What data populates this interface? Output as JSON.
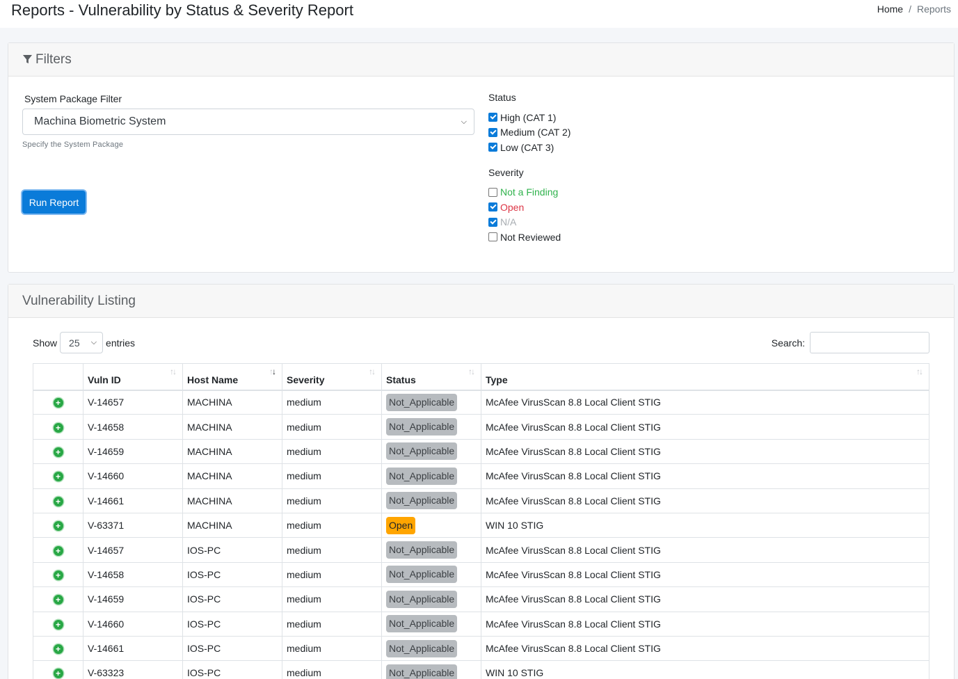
{
  "header": {
    "title": "Reports - Vulnerability by Status & Severity Report"
  },
  "breadcrumb": {
    "home": "Home",
    "separator": "/",
    "current": "Reports"
  },
  "filters": {
    "title": "Filters",
    "system_package": {
      "label": "System Package Filter",
      "value": "Machina Biometric System",
      "help": "Specify the System Package"
    },
    "run_button": "Run Report",
    "status": {
      "title": "Status",
      "options": [
        {
          "label": "High (CAT 1)",
          "checked": true
        },
        {
          "label": "Medium (CAT 2)",
          "checked": true
        },
        {
          "label": "Low (CAT 3)",
          "checked": true
        }
      ]
    },
    "severity": {
      "title": "Severity",
      "options": [
        {
          "label": "Not a Finding",
          "checked": false,
          "color": "#2fb24c"
        },
        {
          "label": "Open",
          "checked": true,
          "color": "#dc3545"
        },
        {
          "label": "N/A",
          "checked": true,
          "color": "#a8adb2"
        },
        {
          "label": "Not Reviewed",
          "checked": false,
          "color": "#212529"
        }
      ]
    }
  },
  "listing": {
    "title": "Vulnerability Listing",
    "show_label": "Show",
    "entries_value": "25",
    "entries_label": "entries",
    "search_label": "Search:",
    "columns": [
      "Vuln ID",
      "Host Name",
      "Severity",
      "Status",
      "Type"
    ],
    "rows": [
      [
        "V-14657",
        "MACHINA",
        "medium",
        "Not_Applicable",
        "McAfee VirusScan 8.8 Local Client STIG"
      ],
      [
        "V-14658",
        "MACHINA",
        "medium",
        "Not_Applicable",
        "McAfee VirusScan 8.8 Local Client STIG"
      ],
      [
        "V-14659",
        "MACHINA",
        "medium",
        "Not_Applicable",
        "McAfee VirusScan 8.8 Local Client STIG"
      ],
      [
        "V-14660",
        "MACHINA",
        "medium",
        "Not_Applicable",
        "McAfee VirusScan 8.8 Local Client STIG"
      ],
      [
        "V-14661",
        "MACHINA",
        "medium",
        "Not_Applicable",
        "McAfee VirusScan 8.8 Local Client STIG"
      ],
      [
        "V-63371",
        "MACHINA",
        "medium",
        "Open",
        "WIN 10 STIG"
      ],
      [
        "V-14657",
        "IOS-PC",
        "medium",
        "Not_Applicable",
        "McAfee VirusScan 8.8 Local Client STIG"
      ],
      [
        "V-14658",
        "IOS-PC",
        "medium",
        "Not_Applicable",
        "McAfee VirusScan 8.8 Local Client STIG"
      ],
      [
        "V-14659",
        "IOS-PC",
        "medium",
        "Not_Applicable",
        "McAfee VirusScan 8.8 Local Client STIG"
      ],
      [
        "V-14660",
        "IOS-PC",
        "medium",
        "Not_Applicable",
        "McAfee VirusScan 8.8 Local Client STIG"
      ],
      [
        "V-14661",
        "IOS-PC",
        "medium",
        "Not_Applicable",
        "McAfee VirusScan 8.8 Local Client STIG"
      ],
      [
        "V-63323",
        "IOS-PC",
        "medium",
        "Not_Applicable",
        "WIN 10 STIG"
      ]
    ]
  },
  "icons": {
    "filter": "filter-icon",
    "expand": "plus-circle-icon",
    "sort": "sort-arrows-icon",
    "dropdown": "chevron-down-icon"
  },
  "colors": {
    "primary": "#0a7bd9",
    "open_badge": "#ffa500",
    "na_badge": "#b7bbbf",
    "expand_icon": "#28a745"
  }
}
